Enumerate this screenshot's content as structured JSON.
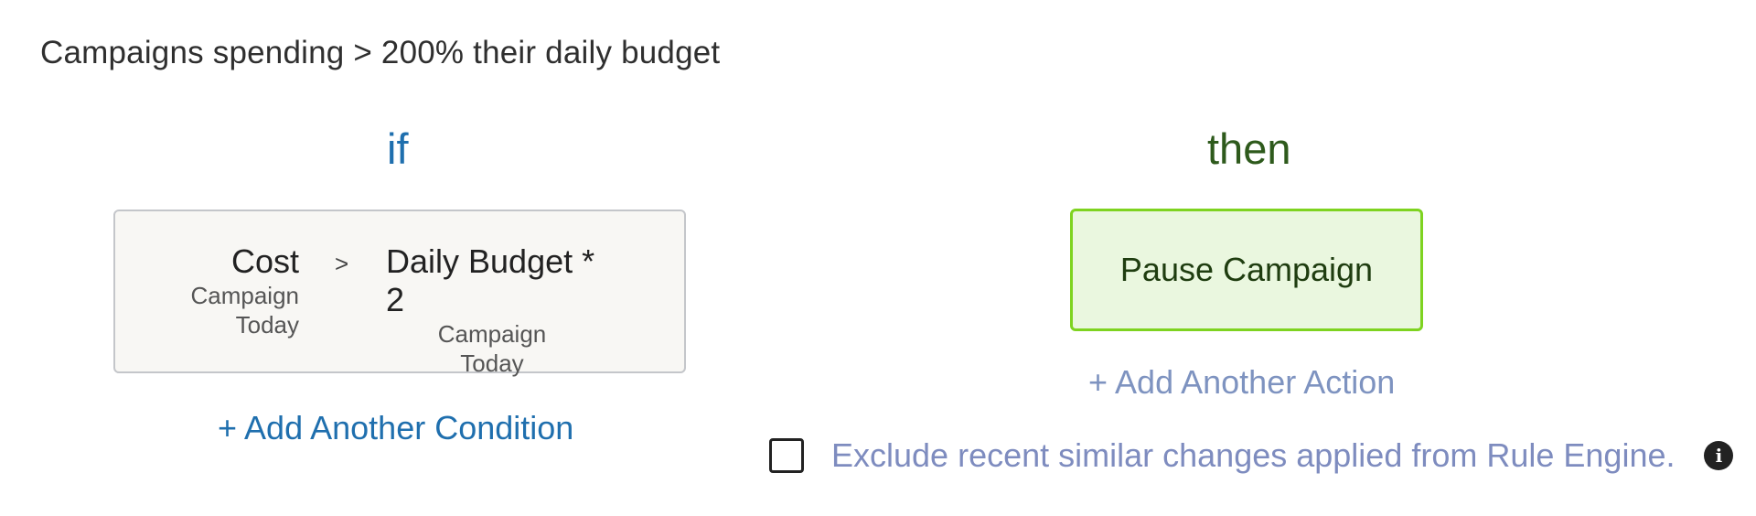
{
  "rule": {
    "title": "Campaigns spending > 200% their daily budget"
  },
  "conditions": {
    "heading": "if",
    "items": [
      {
        "left": {
          "metric": "Cost",
          "scope": "Campaign",
          "period": "Today"
        },
        "operator": ">",
        "right": {
          "metric": "Daily Budget * 2",
          "scope": "Campaign",
          "period": "Today"
        }
      }
    ],
    "add_label": "+ Add Another Condition"
  },
  "actions": {
    "heading": "then",
    "items": [
      {
        "label": "Pause Campaign"
      }
    ],
    "add_label": "+ Add Another Action"
  },
  "exclude": {
    "label": "Exclude recent similar changes applied from Rule Engine.",
    "checked": false,
    "info_icon": "info-icon"
  },
  "colors": {
    "if_heading": "#1f6fae",
    "then_heading": "#2e5a1c",
    "action_border": "#7ed320",
    "action_fill": "#eaf7df",
    "link_muted": "#7e8cbf"
  }
}
